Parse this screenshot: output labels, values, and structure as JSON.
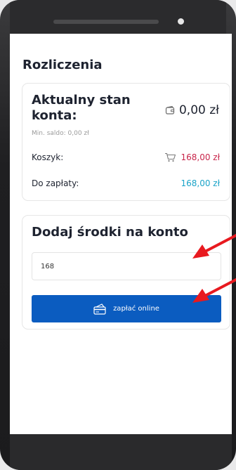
{
  "page": {
    "title": "Rozliczenia"
  },
  "balance": {
    "title": "Aktualny stan konta:",
    "amount": "0,00 zł",
    "min_saldo": "Min. saldo: 0,00 zł",
    "cart_label": "Koszyk:",
    "cart_amount": "168,00 zł",
    "to_pay_label": "Do zapłaty:",
    "to_pay_amount": "168,00 zł"
  },
  "add_funds": {
    "title": "Dodaj środki na konto",
    "input_value": "168",
    "button_label": "zapłać online"
  },
  "colors": {
    "accent_blue": "#0b5cc0",
    "cart_red": "#c8254a",
    "pay_cyan": "#1aa3c8",
    "annotation_arrow": "#e8191f"
  },
  "icons": [
    "wallet-icon",
    "cart-icon",
    "card-payment-icon"
  ]
}
